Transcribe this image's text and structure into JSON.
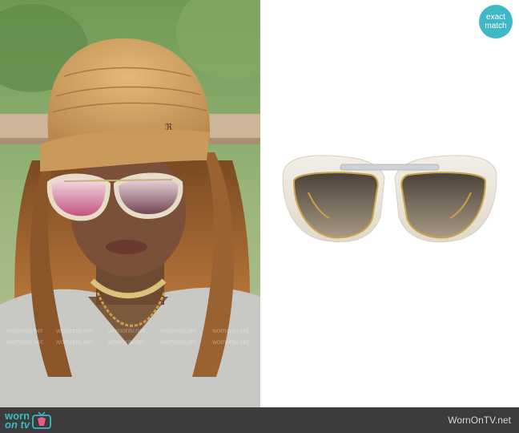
{
  "badge": {
    "line1": "exact",
    "line2": "match"
  },
  "footer": {
    "logo_top": "worn",
    "logo_bottom": "on tv",
    "site": "WornOnTV.net"
  },
  "watermark": "wornontv.net",
  "colors": {
    "accent": "#3eb8c4",
    "footer_bg": "#3c3c3c"
  }
}
